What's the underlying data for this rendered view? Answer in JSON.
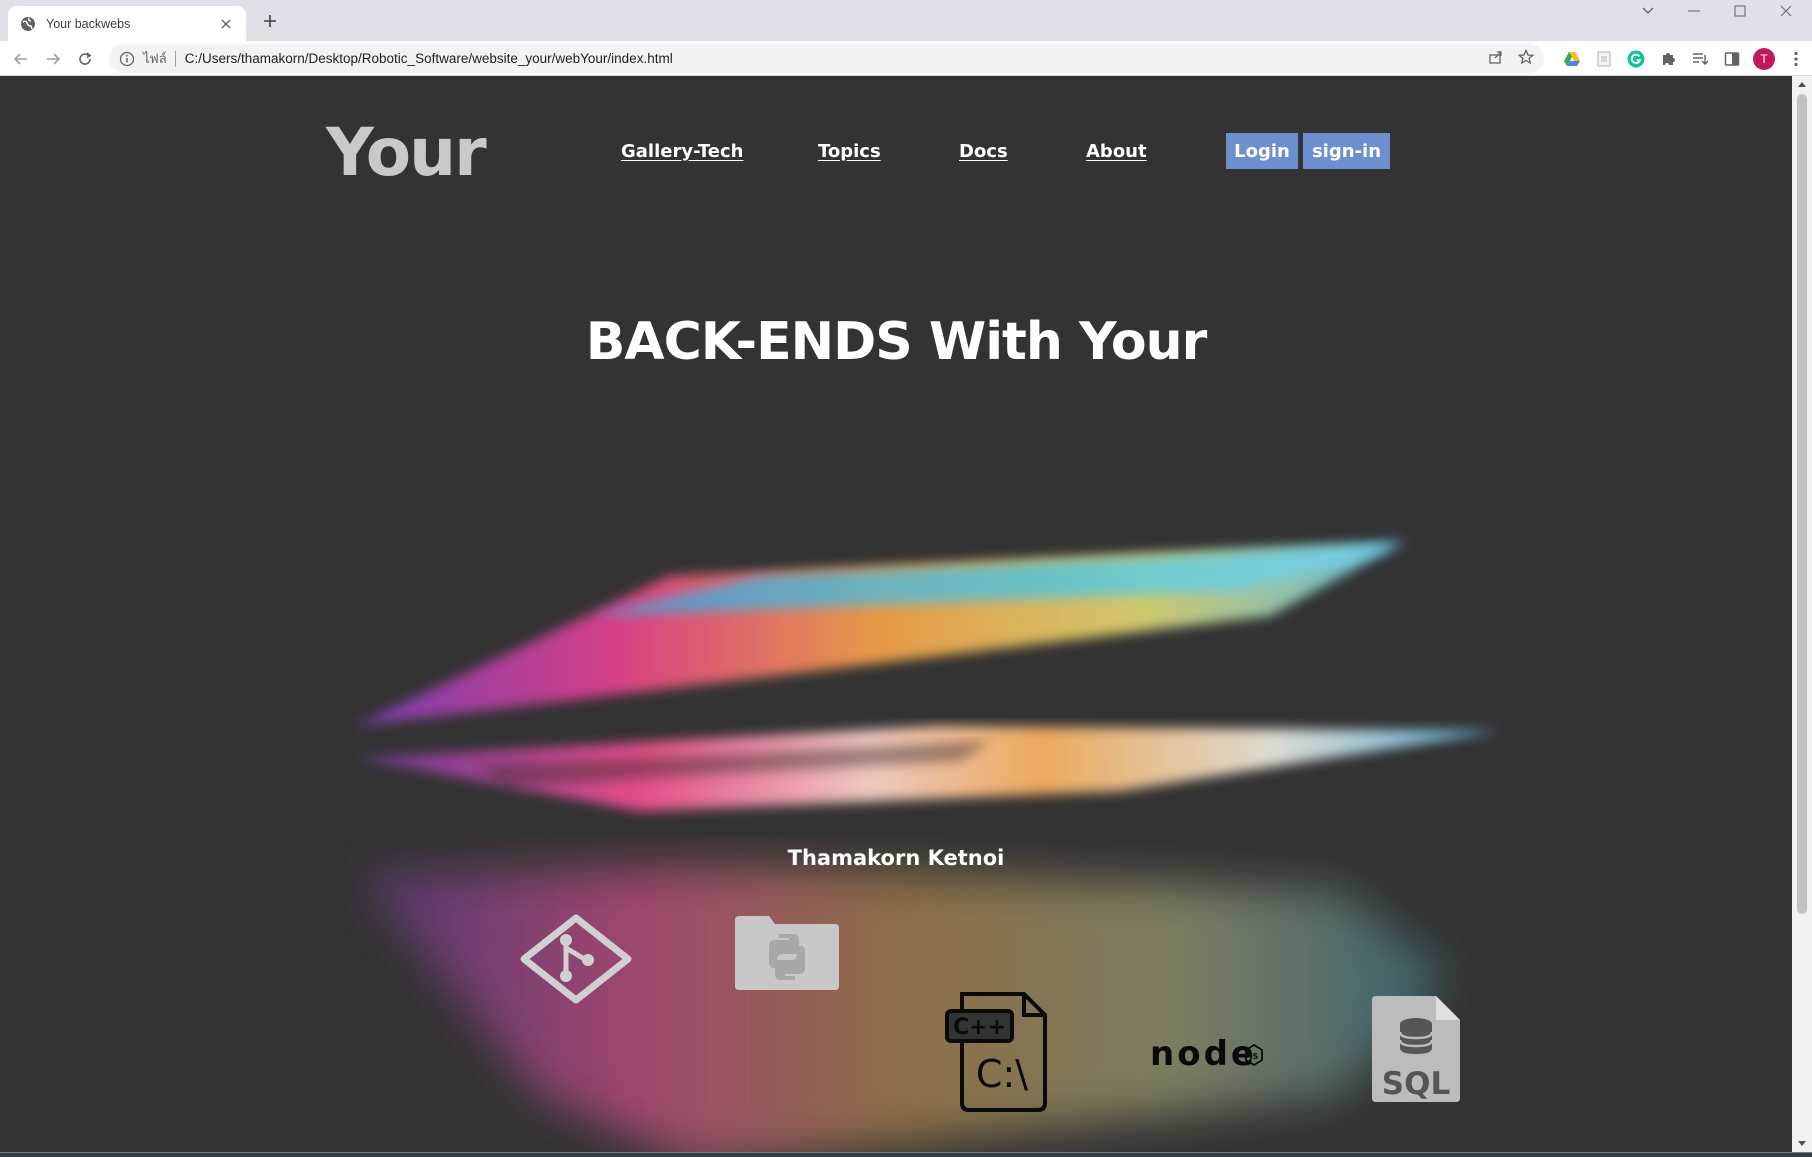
{
  "browser": {
    "tab_title": "Your backwebs",
    "url_scheme_label": "ไฟล์",
    "url": "C:/Users/thamakorn/Desktop/Robotic_Software/website_your/webYour/index.html",
    "profile_initial": "T"
  },
  "site": {
    "logo": "Your",
    "nav": [
      {
        "label": "Gallery-Tech"
      },
      {
        "label": "Topics"
      },
      {
        "label": "Docs"
      },
      {
        "label": "About"
      }
    ],
    "login_label": "Login",
    "signin_label": "sign-in",
    "hero_title": "BACK-ENDS With Your",
    "author": "Thamakorn Ketnoi",
    "tech_icons": [
      {
        "name": "git-icon"
      },
      {
        "name": "python-icon"
      },
      {
        "name": "cpp-file-icon",
        "label": "C++",
        "sublabel": "C:\\"
      },
      {
        "name": "nodejs-icon",
        "label": "node",
        "badge": "JS"
      },
      {
        "name": "sql-file-icon",
        "label": "SQL"
      }
    ],
    "colors": {
      "background": "#333333",
      "button": "#6d8fcf",
      "logo": "#c9c9c9",
      "text": "#ffffff"
    }
  }
}
